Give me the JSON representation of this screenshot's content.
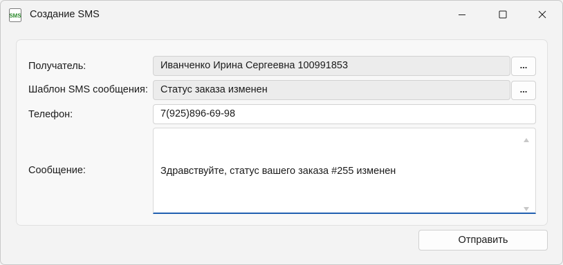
{
  "window": {
    "title": "Создание SMS",
    "icon": "sms-icon",
    "icon_text": "SMS",
    "controls": [
      "minimize-icon",
      "maximize-icon",
      "close-icon"
    ]
  },
  "form": {
    "recipient": {
      "label": "Получатель:",
      "value": "Иванченко Ирина Сергеевна 100991853",
      "browse_label": "..."
    },
    "template": {
      "label": "Шаблон SMS сообщения:",
      "value": "Статус заказа изменен",
      "browse_label": "..."
    },
    "phone": {
      "label": "Телефон:",
      "value": "7(925)896-69-98"
    },
    "message": {
      "label": "Сообщение:",
      "value": "Здравствуйте, статус вашего заказа #255 изменен"
    }
  },
  "actions": {
    "send_label": "Отправить"
  },
  "colors": {
    "accent": "#1f5fb0",
    "icon_green": "#2e8b2e"
  }
}
